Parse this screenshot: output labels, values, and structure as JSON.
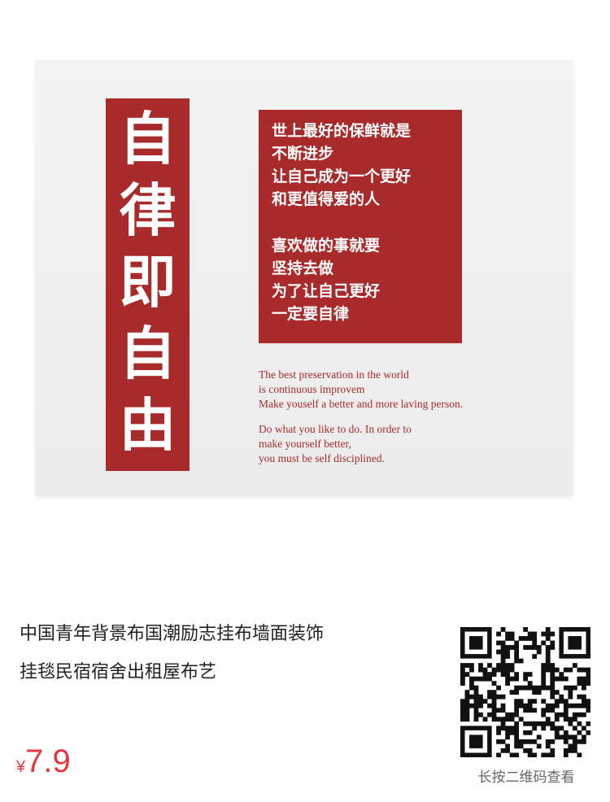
{
  "product_image": {
    "vertical_banner_chars": [
      "自",
      "律",
      "即",
      "自",
      "由"
    ],
    "chinese_block_lines": [
      "世上最好的保鲜就是",
      "不断进步",
      "让自己成为一个更好",
      "和更值得爱的人",
      "",
      "喜欢做的事就要",
      "坚持去做",
      "为了让自己更好",
      "一定要自律"
    ],
    "english_lines": [
      "The best preservation in the world",
      "is continuous improvem",
      "Make youself  a better and more laving person.",
      "",
      "Do what  you like to do. In  order to",
      "make yourself better,",
      "you must be self disciplined."
    ],
    "accent_color": "#a82a2a"
  },
  "product_info": {
    "title_lines": [
      "中国青年背景布国潮励志挂布墙面装饰",
      "挂毯民宿宿舍出租屋布艺"
    ],
    "price_currency": "¥",
    "price_value": "7.9",
    "price_color": "#e4393c"
  },
  "qr": {
    "icon": "qr-code-icon",
    "caption": "长按二维码查看"
  }
}
